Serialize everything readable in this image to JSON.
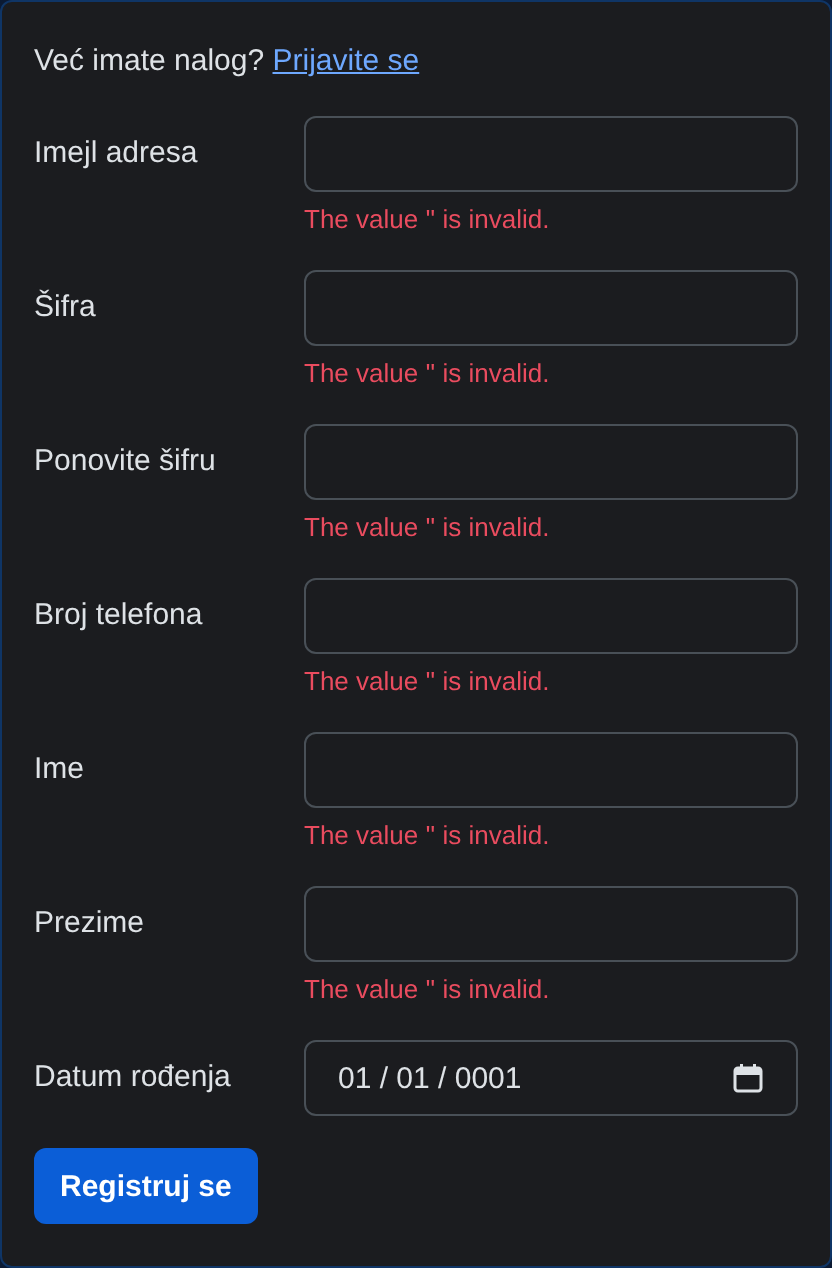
{
  "login_prompt": {
    "text": "Već imate nalog?",
    "link": "Prijavite se"
  },
  "fields": [
    {
      "label": "Imejl adresa",
      "kind": "text",
      "error": "The value '' is invalid."
    },
    {
      "label": "Šifra",
      "kind": "text",
      "error": "The value '' is invalid."
    },
    {
      "label": "Ponovite šifru",
      "kind": "text",
      "error": "The value '' is invalid."
    },
    {
      "label": "Broj telefona",
      "kind": "text",
      "error": "The value '' is invalid."
    },
    {
      "label": "Ime",
      "kind": "text",
      "error": "The value '' is invalid."
    },
    {
      "label": "Prezime",
      "kind": "text",
      "error": "The value '' is invalid."
    },
    {
      "label": "Datum rođenja",
      "kind": "date",
      "value": "01 / 01 / 0001"
    }
  ],
  "submit_button": "Registruj se"
}
